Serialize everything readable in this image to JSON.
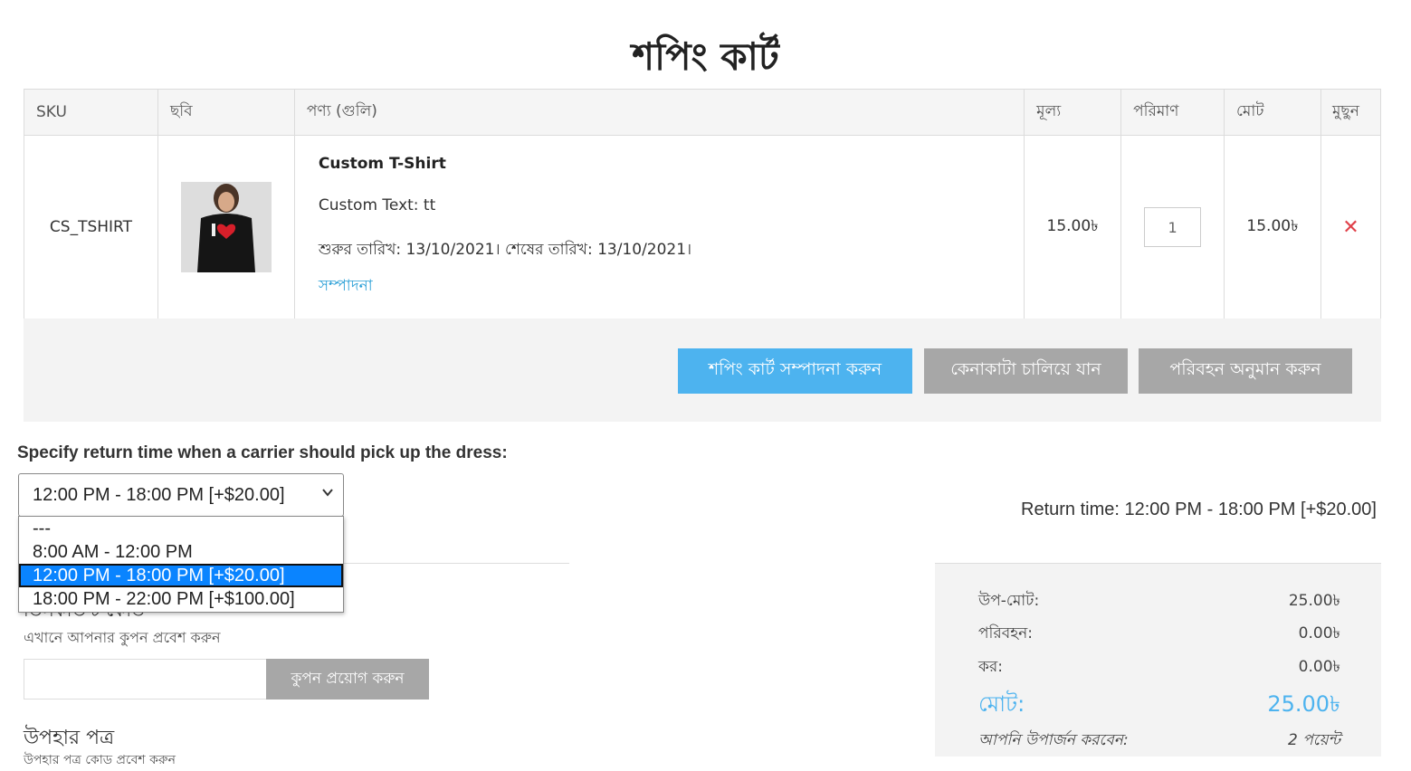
{
  "page": {
    "title": "শপিং কার্ট"
  },
  "cart": {
    "headers": [
      "SKU",
      "ছবি",
      "পণ্য (গুলি)",
      "মূল্য",
      "পরিমাণ",
      "মোট",
      "মুছুন"
    ],
    "item": {
      "sku": "CS_TSHIRT",
      "name": "Custom T-Shirt",
      "option": "Custom Text: tt",
      "dates": "শুরুর তারিখ: 13/10/2021। শেষের তারিখ: 13/10/2021।",
      "edit_link": "সম্পাদনা",
      "price": "15.00৳",
      "qty": "1",
      "total": "15.00৳"
    }
  },
  "buttons": {
    "edit_cart": "শপিং কার্ট সম্পাদনা করুন",
    "continue_shopping": "কেনাকাটা চালিয়ে যান",
    "estimate_shipping": "পরিবহন অনুমান করুন"
  },
  "return_time": {
    "label": "Specify return time when a carrier should pick up the dress:",
    "selected": "12:00 PM - 18:00 PM [+$20.00]",
    "options": [
      "---",
      "8:00 AM - 12:00 PM",
      "12:00 PM - 18:00 PM [+$20.00]",
      "18:00 PM - 22:00 PM [+$100.00]"
    ],
    "summary": "Return time: 12:00 PM - 18:00 PM [+$20.00]"
  },
  "coupon": {
    "heading": "ডিসকাউন্ট কোড",
    "hint": "এখানে আপনার কুপন প্রবেশ করুন",
    "value": "",
    "apply": "কুপন প্রয়োগ করুন"
  },
  "gift": {
    "heading": "উপহার পত্র",
    "sub": "উপহার পত্র কোড প্রবেশ করুন"
  },
  "totals": {
    "subtotal_label": "উপ-মোট:",
    "subtotal": "25.00৳",
    "shipping_label": "পরিবহন:",
    "shipping": "0.00৳",
    "tax_label": "কর:",
    "tax": "0.00৳",
    "total_label": "মোট:",
    "total": "25.00৳",
    "earn_label": "আপনি উপার্জন করবেন:",
    "earn": "2 পয়েন্ট"
  },
  "colors": {
    "accent": "#4db3ef",
    "delete": "#e0414a",
    "selected_option": "#0a84ff"
  }
}
